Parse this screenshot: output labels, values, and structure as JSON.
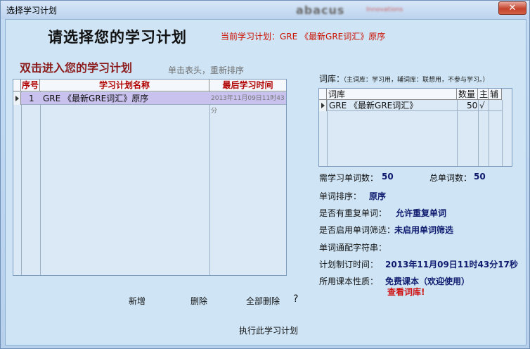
{
  "window": {
    "title": "选择学习计划",
    "brand": "abacus",
    "brand_sub": "Innovations",
    "close_glyph": "✕"
  },
  "header": {
    "title": "请选择您的学习计划",
    "current_plan": "当前学习计划：GRE  《最新GRE词汇》原序",
    "subtitle": "双击进入您的学习计划",
    "sort_hint": "单击表头，重新排序"
  },
  "plan_table": {
    "columns": [
      "序号",
      "学习计划名称",
      "最后学习时间"
    ],
    "rows": [
      {
        "index": "1",
        "name": "GRE 《最新GRE词汇》原序",
        "last_time": "2013年11月09日11时43分"
      }
    ]
  },
  "library": {
    "label": "词库：",
    "note": "（主词库：学习用，辅词库：联想用，不参与学习。）",
    "columns": [
      "词库",
      "数量",
      "主",
      "辅"
    ],
    "rows": [
      {
        "name": "GRE 《最新GRE词汇》",
        "count": "50",
        "main": "√",
        "aux": ""
      }
    ]
  },
  "info": {
    "need_words_label": "需学习单词数：",
    "need_words_value": "50",
    "total_words_label": "总单词数：",
    "total_words_value": "50",
    "sort_label": "单词排序：",
    "sort_value": "原序",
    "repeat_label": "是否有重复单词：",
    "repeat_value": "允许重复单词",
    "filter_label": "是否启用单词筛选：",
    "filter_value": "未启用单词筛选",
    "wildcard_label": "单词通配字符串：",
    "wildcard_value": "",
    "made_time_label": "计划制订时间：",
    "made_time_value": "2013年11月09日11时43分17秒",
    "course_label": "所用课本性质：",
    "course_value": "免费课本（欢迎使用）",
    "view_lib_link": "查看词库!"
  },
  "buttons": {
    "add": "新增",
    "delete": "删除",
    "delete_all": "全部删除",
    "help": "?",
    "execute": "执行此学习计划"
  }
}
